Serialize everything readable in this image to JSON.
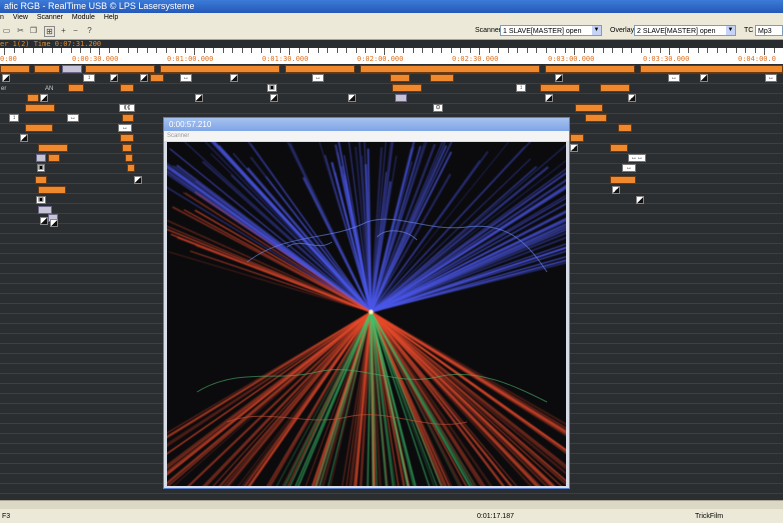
{
  "window": {
    "title": "afic RGB - RealTime USB © LPS Lasersysteme"
  },
  "menu": {
    "items": [
      "n",
      "View",
      "Scanner",
      "Module",
      "Help"
    ]
  },
  "toolbar": {
    "scanner_label": "Scanner",
    "scanner_value": "1 SLAVE[MASTER] open",
    "overlay_label": "Overlay",
    "overlay_value": "2 SLAVE[MASTER] open",
    "tc_label": "TC",
    "tc_value": "Mp3"
  },
  "info": {
    "text": "er 1(2)  Time 0:07:31.200"
  },
  "ruler": {
    "labels": [
      "0:00",
      "0:00:30.000",
      "0:01:00.000",
      "0:01:30.000",
      "0:02:00.000",
      "0:02:30.000",
      "0:03:00.000",
      "0:03:30.000",
      "0:04:00.0"
    ]
  },
  "tracks": {
    "name1": "er",
    "name2": "AN"
  },
  "scanner": {
    "time": "0:00:57.210",
    "subtitle": "Scanner"
  },
  "status": {
    "left": "F3",
    "center": "0:01:17.187",
    "right": "TrickFilm"
  },
  "colors": {
    "block": "#f0892e",
    "timecode": "#e07020",
    "beam_blue": "#4a56e8",
    "beam_red": "#e84a2a",
    "beam_green": "#3ac46a"
  }
}
